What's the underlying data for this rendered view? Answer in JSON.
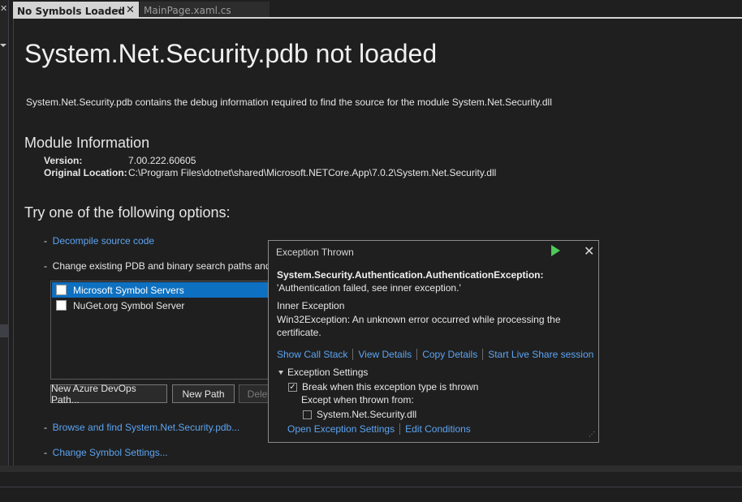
{
  "tabs": {
    "active": {
      "label": "No Symbols Loaded",
      "pin": "⊣",
      "close": "✕"
    },
    "inactive": {
      "label": "MainPage.xaml.cs"
    }
  },
  "left": {
    "close": "✕"
  },
  "doc": {
    "title": "System.Net.Security.pdb not loaded",
    "description": "System.Net.Security.pdb contains the debug information required to find the source for the module System.Net.Security.dll",
    "module_heading": "Module Information",
    "version_label": "Version:",
    "version_value": "7.00.222.60605",
    "location_label": "Original Location:",
    "location_value": "C:\\Program Files\\dotnet\\shared\\Microsoft.NETCore.App\\7.0.2\\System.Net.Security.dll",
    "options_heading": "Try one of the following options:",
    "bullet": "-",
    "decompile_link": "Decompile source code",
    "change_text": "Change existing PDB and binary search paths and r",
    "symbol_servers": [
      {
        "label": "Microsoft Symbol Servers",
        "checked": false,
        "selected": true
      },
      {
        "label": "NuGet.org Symbol Server",
        "checked": false,
        "selected": false
      }
    ],
    "btn_azure": "New Azure DevOps Path...",
    "btn_new_path": "New Path",
    "btn_delete": "Delete",
    "browse_link": "Browse and find System.Net.Security.pdb...",
    "change_symbol_link": "Change Symbol Settings..."
  },
  "popup": {
    "title": "Exception Thrown",
    "exception_name": "System.Security.Authentication.AuthenticationException:",
    "exception_message": "'Authentication failed, see inner exception.'",
    "inner_heading": "Inner Exception",
    "inner_message": "Win32Exception: An unknown error occurred while processing the certificate.",
    "links": [
      "Show Call Stack",
      "View Details",
      "Copy Details",
      "Start Live Share session"
    ],
    "settings_heading": "Exception Settings",
    "break_label": "Break when this exception type is thrown",
    "break_check": "✓",
    "except_label": "Except when thrown from:",
    "module_label": "System.Net.Security.dll",
    "links2": [
      "Open Exception Settings",
      "Edit Conditions"
    ],
    "grip": "⋰"
  },
  "colors": {
    "link": "#5ca4f2",
    "selection": "#0e70c0",
    "play": "#4ec95a"
  }
}
